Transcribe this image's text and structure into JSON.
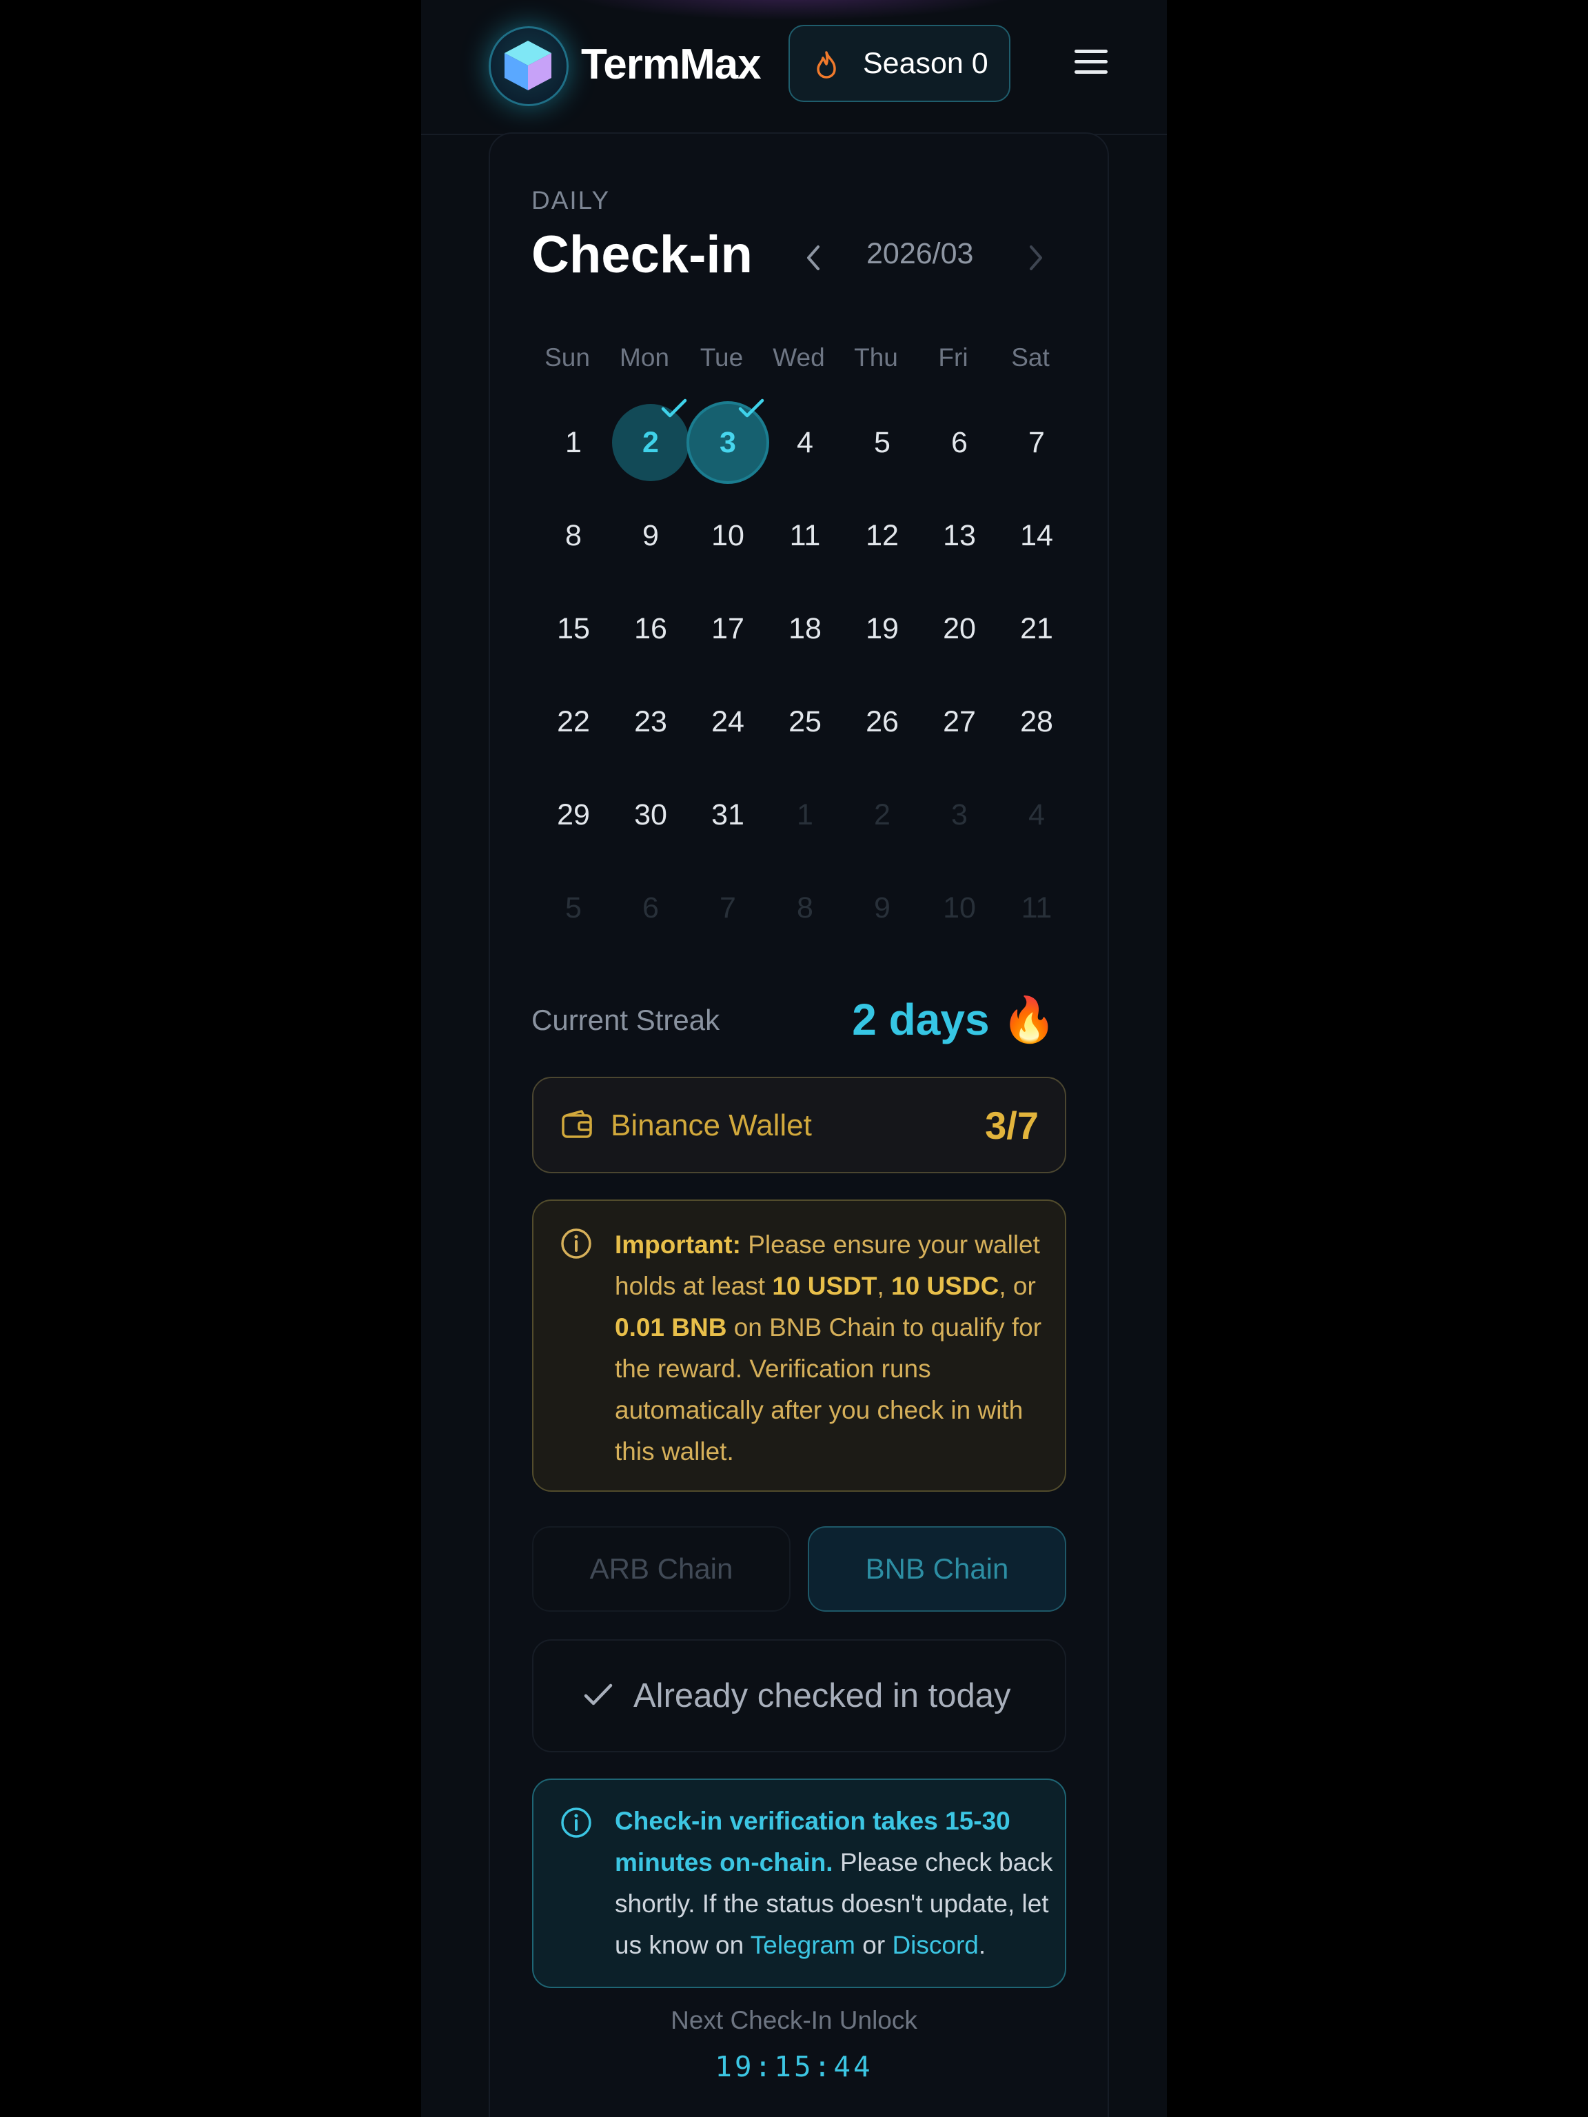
{
  "header": {
    "brand": "TermMax",
    "season_label": "Season 0",
    "icons": {
      "logo": "cube-logo-icon",
      "season": "flame-icon",
      "menu": "hamburger-menu-icon"
    }
  },
  "checkin": {
    "eyebrow": "DAILY",
    "title": "Check-in",
    "month": "2026/03",
    "weekdays": [
      "Sun",
      "Mon",
      "Tue",
      "Wed",
      "Thu",
      "Fri",
      "Sat"
    ],
    "days": [
      [
        "1",
        "2",
        "3",
        "4",
        "5",
        "6",
        "7"
      ],
      [
        "8",
        "9",
        "10",
        "11",
        "12",
        "13",
        "14"
      ],
      [
        "15",
        "16",
        "17",
        "18",
        "19",
        "20",
        "21"
      ],
      [
        "22",
        "23",
        "24",
        "25",
        "26",
        "27",
        "28"
      ],
      [
        "29",
        "30",
        "31",
        "1",
        "2",
        "3",
        "4"
      ],
      [
        "5",
        "6",
        "7",
        "8",
        "9",
        "10",
        "11"
      ]
    ],
    "checked_days": [
      "2",
      "3"
    ],
    "today": "3"
  },
  "streak": {
    "label": "Current Streak",
    "value": "2 days 🔥"
  },
  "wallet": {
    "name": "Binance Wallet",
    "count": "3/7"
  },
  "important": {
    "lead": "Important:",
    "t1": " Please ensure your wallet holds at least ",
    "usdt": "10 USDT",
    "t2": ", ",
    "usdc": "10 USDC",
    "t3": ", or ",
    "bnb": "0.01 BNB",
    "t4": " on BNB Chain to qualify for the reward. Verification runs automatically after you check in with this wallet."
  },
  "chains": {
    "arb": "ARB Chain",
    "bnb": "BNB Chain",
    "selected": "BNB Chain"
  },
  "status": {
    "already": "Already checked in today"
  },
  "verify": {
    "lead": "Check-in verification takes 15-30 minutes on-chain.",
    "t1": " Please check back shortly. If the status doesn't update, let us know on ",
    "telegram": "Telegram",
    "t2": " or ",
    "discord": "Discord",
    "t3": "."
  },
  "unlock": {
    "label": "Next Check-In Unlock",
    "countdown": "19:15:44"
  },
  "colors": {
    "accent": "#3cc6e3",
    "warning": "#e2b43c",
    "background": "#0a0e14"
  }
}
